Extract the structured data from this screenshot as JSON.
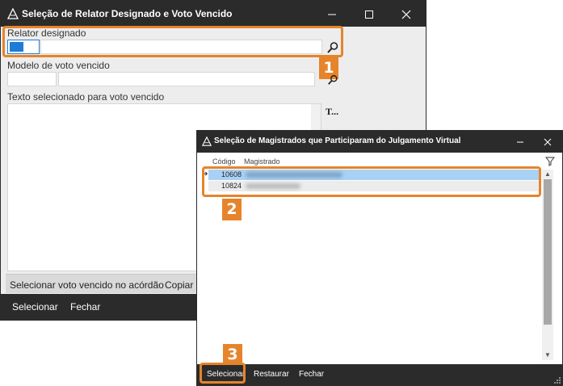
{
  "window1": {
    "title": "Seleção de Relator Designado e Voto Vencido",
    "relator_label": "Relator designado",
    "modelo_label": "Modelo de voto vencido",
    "texto_label": "Texto selecionado para voto vencido",
    "text_tool_label": "T...",
    "button_bar": {
      "select_label": "Selecionar voto vencido no acórdão",
      "copy_label": "Copiar i"
    },
    "footer": {
      "select_label": "Selecionar",
      "close_label": "Fechar"
    }
  },
  "window2": {
    "title": "Seleção de Magistrados que Participaram do Julgamento Virtual",
    "columns": [
      "Código",
      "Magistrado"
    ],
    "rows": [
      {
        "code": "10608"
      },
      {
        "code": "10824"
      }
    ],
    "footer": {
      "select_label": "Selecionar",
      "restore_label": "Restaurar",
      "close_label": "Fechar"
    }
  },
  "badges": [
    "1",
    "2",
    "3"
  ],
  "colors": {
    "accent": "#e6842b",
    "titlebar": "#2b2b2b",
    "selected_row": "#a9d1f5",
    "focus": "#1e7bd6"
  }
}
